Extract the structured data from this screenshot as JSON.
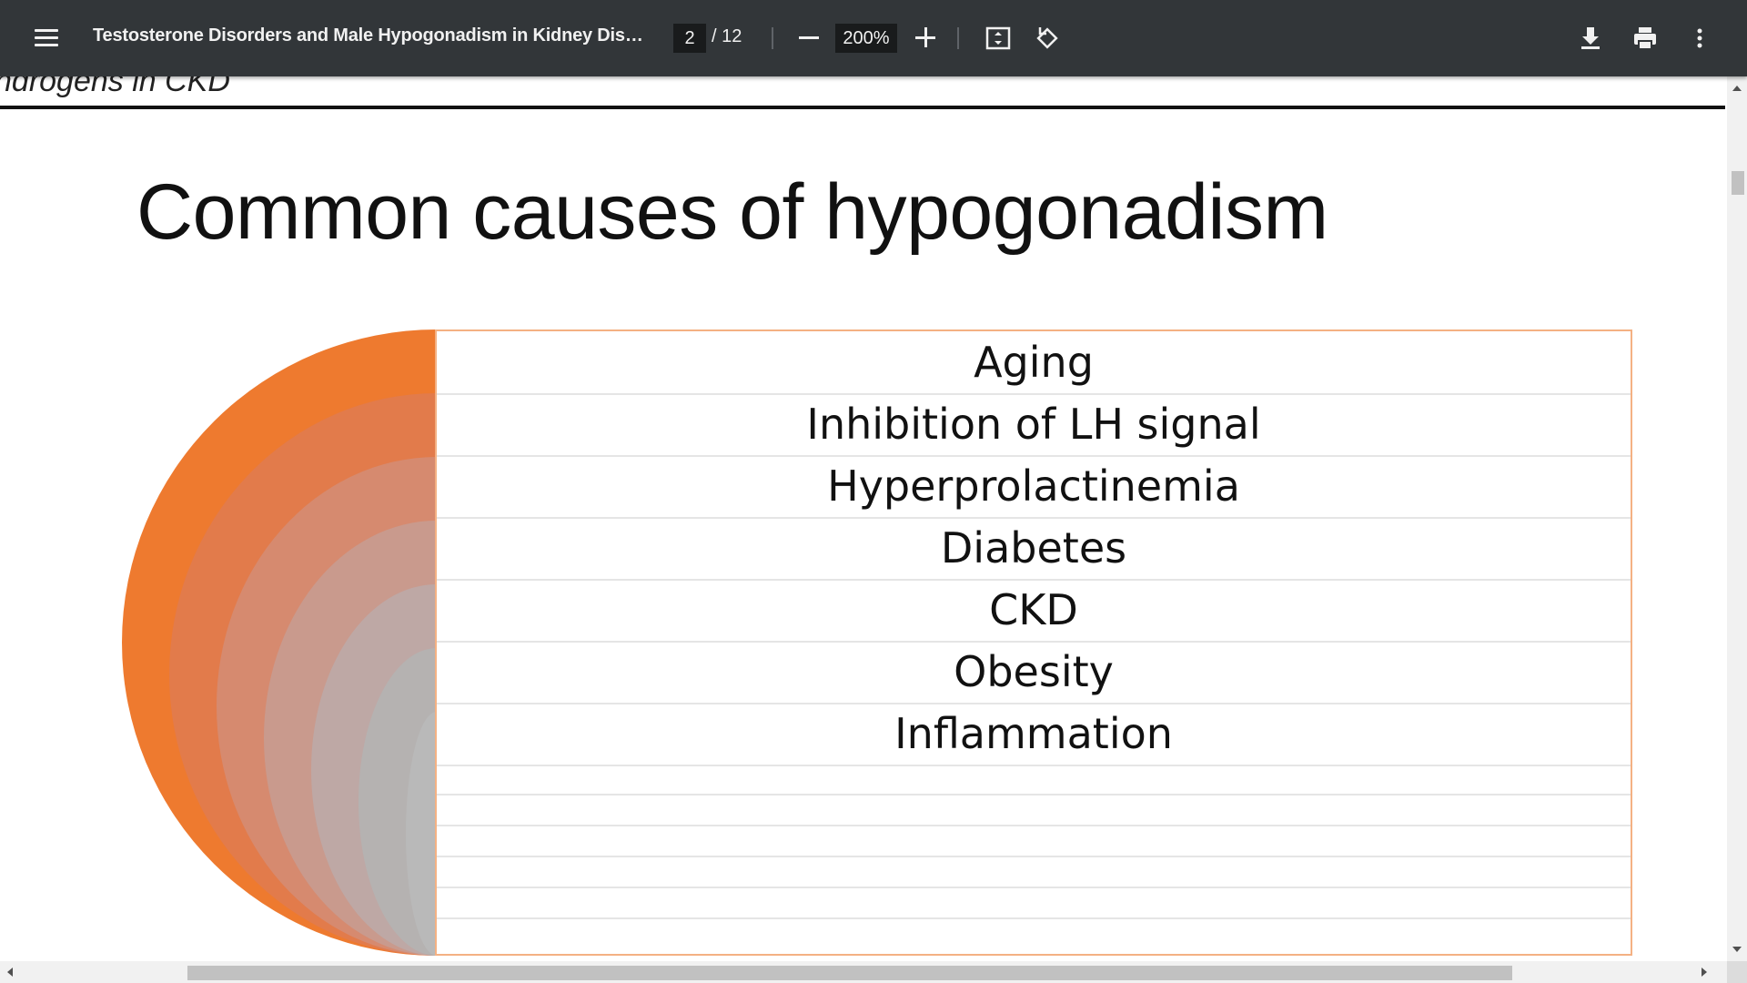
{
  "toolbar": {
    "title": "Testosterone Disorders and Male Hypogonadism in Kidney Dise...",
    "page_current": "2",
    "page_total": "/ 12",
    "zoom": "200%",
    "icons": [
      "menu-icon",
      "zoom-out-icon",
      "zoom-in-icon",
      "fit-page-icon",
      "rotate-icon",
      "download-icon",
      "print-icon",
      "more-vert-icon"
    ]
  },
  "document": {
    "previous_heading": "ndrogens in CKD",
    "slide_title": "Common causes of hypogonadism",
    "causes": [
      "Aging",
      "Inhibition   of LH signal",
      "Hyperprolactinemia",
      "Diabetes",
      "CKD",
      "Obesity",
      "Inflammation"
    ]
  },
  "colors": {
    "toolbar_bg": "#323639",
    "accent_orange": "#ed7d31",
    "table_border": "#f4b183"
  }
}
